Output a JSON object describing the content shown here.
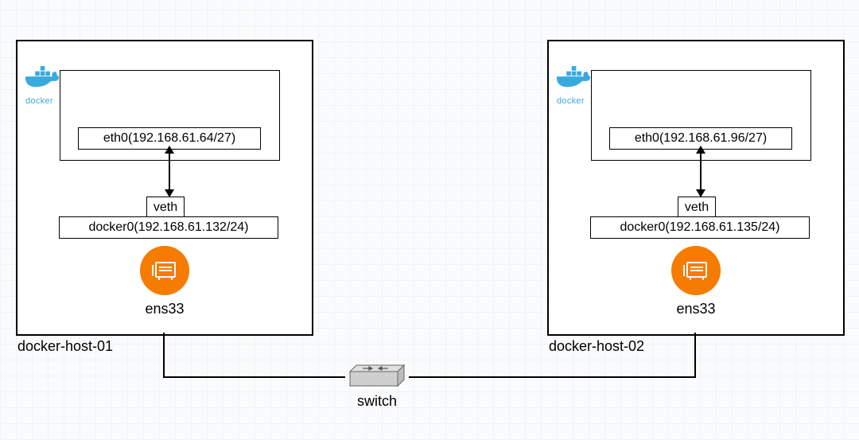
{
  "hosts": [
    {
      "name": "docker-host-01",
      "eth0": "eth0(192.168.61.64/27)",
      "veth": "veth",
      "docker0": "docker0(192.168.61.132/24)",
      "nic": "ens33",
      "logo": "docker"
    },
    {
      "name": "docker-host-02",
      "eth0": "eth0(192.168.61.96/27)",
      "veth": "veth",
      "docker0": "docker0(192.168.61.135/24)",
      "nic": "ens33",
      "logo": "docker"
    }
  ],
  "switch_label": "switch"
}
